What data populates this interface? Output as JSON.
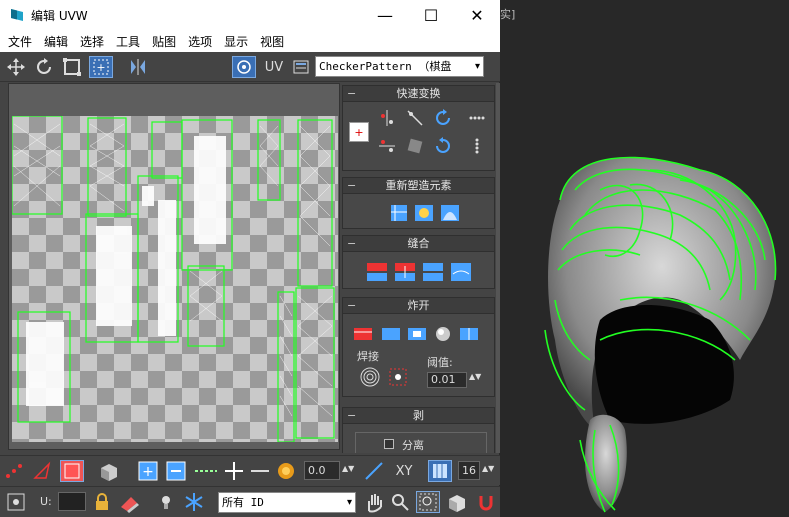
{
  "window": {
    "title": "编辑 UVW",
    "minimize_glyph": "—",
    "maximize_glyph": "☐",
    "close_glyph": "✕"
  },
  "menu": [
    "文件",
    "编辑",
    "选择",
    "工具",
    "贴图",
    "选项",
    "显示",
    "视图"
  ],
  "toolbar": {
    "uv_label": "UV",
    "texture_select": "CheckerPattern （棋盘",
    "icons": [
      "move-icon",
      "rotate-icon",
      "scale-icon",
      "freeform-icon",
      "mirror-icon",
      "render-icon",
      "uv-icon",
      "options-icon"
    ]
  },
  "viewport": {
    "label": "实]"
  },
  "panel": {
    "quick_transform": {
      "title": "快速变换",
      "collapse": "−"
    },
    "reshape": {
      "title": "重新塑造元素",
      "collapse": "−"
    },
    "stitch": {
      "title": "缝合",
      "collapse": "−"
    },
    "explode": {
      "title": "炸开",
      "collapse": "−",
      "weld_label": "焊接",
      "threshold_label": "阈值:",
      "threshold_value": "0.01"
    },
    "peel": {
      "title": "剥",
      "collapse": "−",
      "detach_label": "分离"
    }
  },
  "bottom1": {
    "spinner_value": "0.0",
    "xy_label": "XY",
    "grid_value": "16"
  },
  "bottom2": {
    "u_label": "U:",
    "id_select": "所有 ID"
  },
  "colors": {
    "accent_blue": "#3a6fb5",
    "uv_green": "#22ff22",
    "selection_red": "#ff5555"
  }
}
